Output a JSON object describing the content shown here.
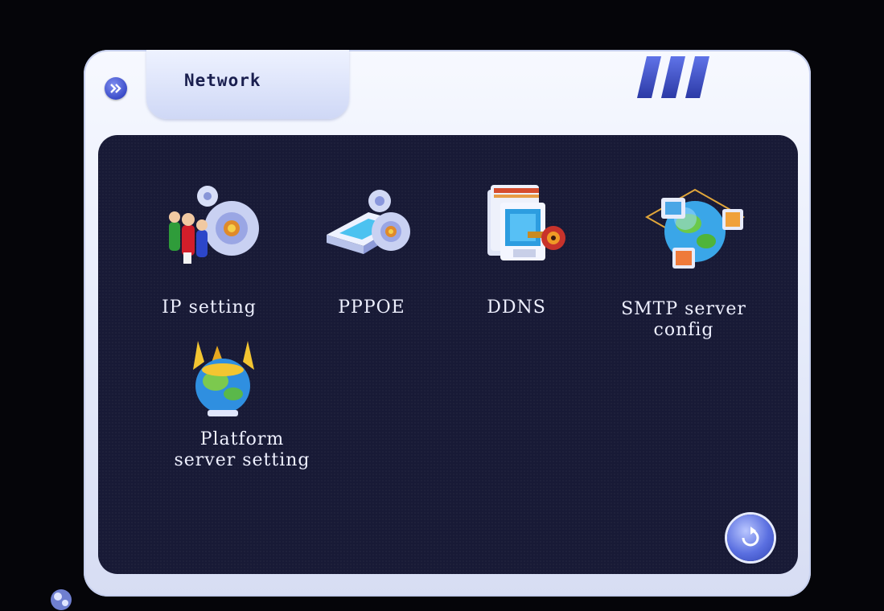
{
  "header": {
    "title": "Network"
  },
  "menu": {
    "items": [
      {
        "label": "IP  setting",
        "icon": "ip-setting-icon"
      },
      {
        "label": "PPPOE",
        "icon": "pppoe-icon"
      },
      {
        "label": "DDNS",
        "icon": "ddns-icon"
      },
      {
        "label": "SMTP  server\nconfig",
        "icon": "smtp-server-icon"
      },
      {
        "label": "Platform\nserver setting",
        "icon": "platform-server-icon"
      }
    ]
  },
  "colors": {
    "panel": "#181a36",
    "frame": "#e8edfb",
    "label_text": "#eef0ff",
    "accent_blue": "#3b4cc9"
  }
}
